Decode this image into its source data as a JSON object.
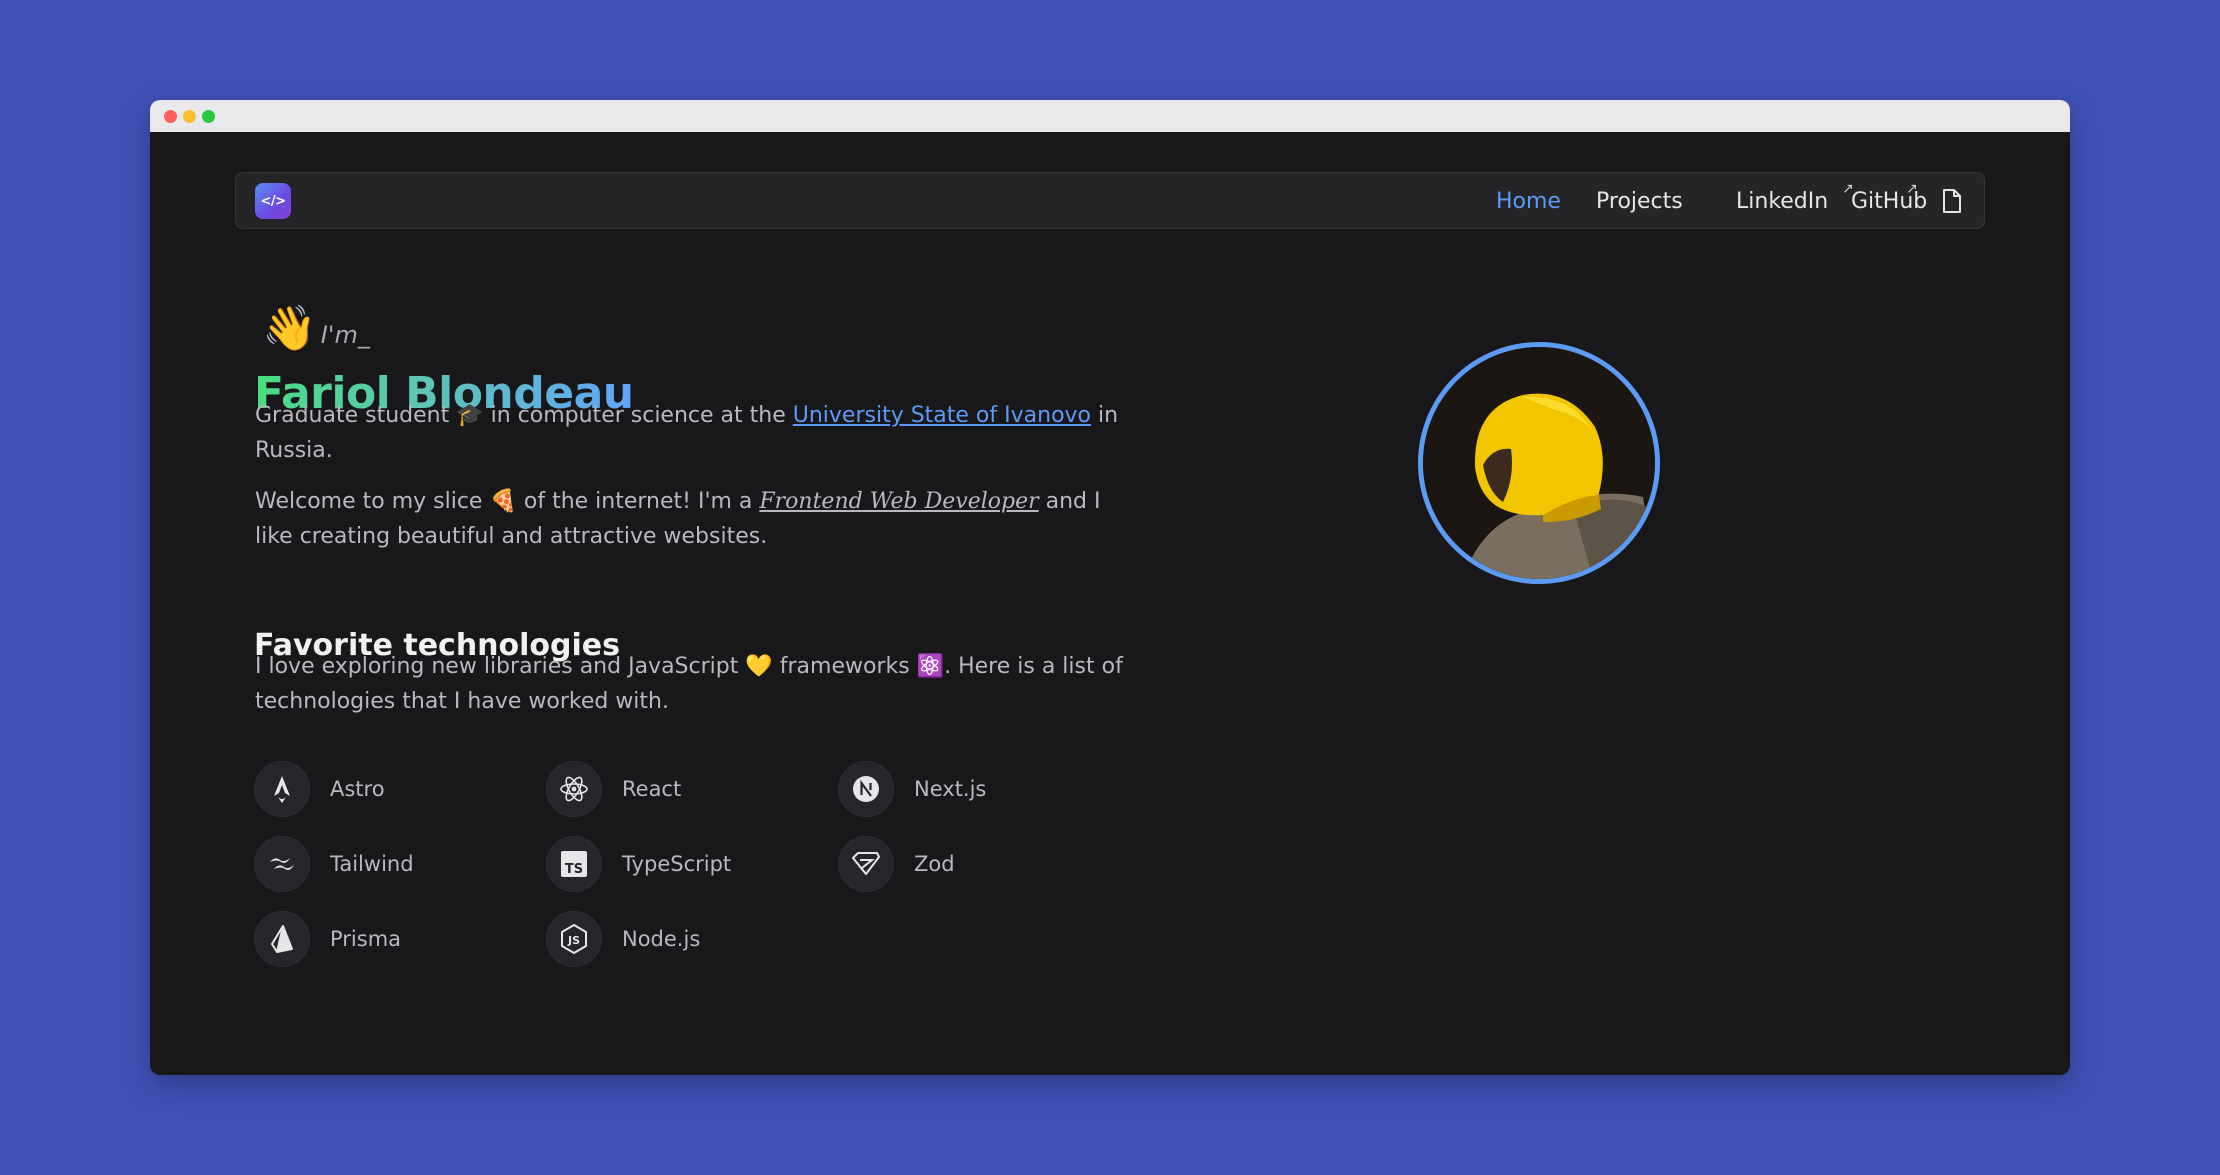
{
  "colors": {
    "background": "#3f51b5",
    "page": "#18181b",
    "accent": "#5b9bf3",
    "name_gradient": [
      "#4ade80",
      "#60a5fa"
    ]
  },
  "navbar": {
    "logo_text": "</>",
    "items": [
      {
        "label": "Home",
        "active": true
      },
      {
        "label": "Projects",
        "active": false
      },
      {
        "label": "LinkedIn",
        "external": true
      },
      {
        "label": "GitHub",
        "external": true
      }
    ],
    "ext_arrow": "↗",
    "resume_icon": "document-icon"
  },
  "hero": {
    "wave_emoji": "👋",
    "intro": "I'm_",
    "name": "Fariol Blondeau",
    "bio1": {
      "before": "Graduate student ",
      "emoji": "🎓",
      "middle": " in computer science at the ",
      "link": "University State of Ivanovo",
      "after": " in Russia."
    },
    "bio2": {
      "before": "Welcome to my slice ",
      "emoji": "🍕",
      "middle": " of the internet! I'm a ",
      "role": "Frontend Web Developer",
      "after": " and I like creating beautiful and attractive websites."
    }
  },
  "technologies": {
    "title": "Favorite technologies",
    "description": {
      "before": "I love exploring new libraries and JavaScript ",
      "emoji1": "💛",
      "middle": " frameworks ",
      "emoji2": "⚛️",
      "after": ". Here is a list of technologies that I have worked with."
    },
    "items": [
      {
        "label": "Astro",
        "icon": "astro-icon"
      },
      {
        "label": "React",
        "icon": "react-icon"
      },
      {
        "label": "Next.js",
        "icon": "nextjs-icon"
      },
      {
        "label": "Tailwind",
        "icon": "tailwind-icon"
      },
      {
        "label": "TypeScript",
        "icon": "typescript-icon"
      },
      {
        "label": "Zod",
        "icon": "zod-icon"
      },
      {
        "label": "Prisma",
        "icon": "prisma-icon"
      },
      {
        "label": "Node.js",
        "icon": "nodejs-icon"
      }
    ]
  }
}
